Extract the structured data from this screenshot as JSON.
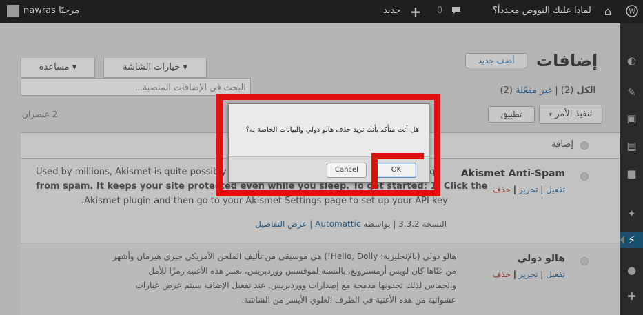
{
  "adminbar": {
    "user_label": "nawras مرحبًا",
    "site_title": "لماذا عليك النووص مجددأ؟",
    "comments_count": "0",
    "new_label": "جديد"
  },
  "header": {
    "page_title": "إضافات",
    "add_new": "أضف جديد",
    "screen_options": "خيارات الشاشة ▾",
    "help": "مساعدة ▾"
  },
  "filters": {
    "all_label": "الكل",
    "all_count": "(2)",
    "sep": "|",
    "inactive_label": "غير مفعّلة",
    "inactive_count": "(2)"
  },
  "search": {
    "placeholder": "البحث في الإضافات المنصبة..."
  },
  "bulk": {
    "action_label": "تنفيذ الأمر",
    "apply": "تطبيق"
  },
  "items_count": "2 عنصران",
  "table": {
    "col_plugin": "إضافة"
  },
  "plugins": [
    {
      "name": "Akismet Anti-Spam",
      "activate": "تفعيل",
      "edit": "تحرير",
      "delete": "حذف",
      "desc_1": "Used by millions, Akismet is quite possibly the best way in the world to protect your blog",
      "desc_2": "from spam. It keeps your site protected even while you sleep. To get started: 1) Click the",
      "desc_3": ".Akismet plugin and then go to your Akismet Settings page to set up your API key",
      "meta_version": "النسخة 3.3.2",
      "meta_by": "| بواسطة",
      "meta_author": "Automattic",
      "meta_details": "| عرض التفاصيل"
    },
    {
      "name": "هالو دولي",
      "activate": "تفعيل",
      "edit": "تحرير",
      "delete": "حذف",
      "desc_1": "هالو دولي (بالإنجليزية: Hello, Dolly!) هي موسيقى من تأليف الملحن الأمريكي جيري هيرمان وأشهر",
      "desc_2": "من غنّاها كان لويس أرمسترونغ. بالنسبة لموقسس ووردبريس، تعتبر هذه الأغنية رمزًا للأمل",
      "desc_3": "والحماس لذلك تجدونها مدمجة مع إصدارات ووردبريس. عند تفعيل الإضافة سيتم عرض عبارات",
      "desc_4": "عشوائية من هذه الأغنية في الطرف العلوي الأيسر من الشاشة."
    }
  ],
  "dialog": {
    "message": "هل أنت متأكد بأنك تريد حذف هالو دولي والبيانات الخاصة به؟",
    "cancel": "Cancel",
    "ok": "OK"
  },
  "colors": {
    "highlight": "#e01010",
    "adminbar": "#1f1f1f",
    "sidebar": "#2a2a2a"
  },
  "icons": [
    "wordpress-icon",
    "home-icon",
    "comment-icon",
    "plus-icon",
    "avatar-icon",
    "dashboard-icon",
    "posts-icon",
    "media-icon",
    "pages-icon",
    "comments-icon",
    "appearance-icon",
    "plugins-icon",
    "users-icon",
    "tools-icon"
  ]
}
